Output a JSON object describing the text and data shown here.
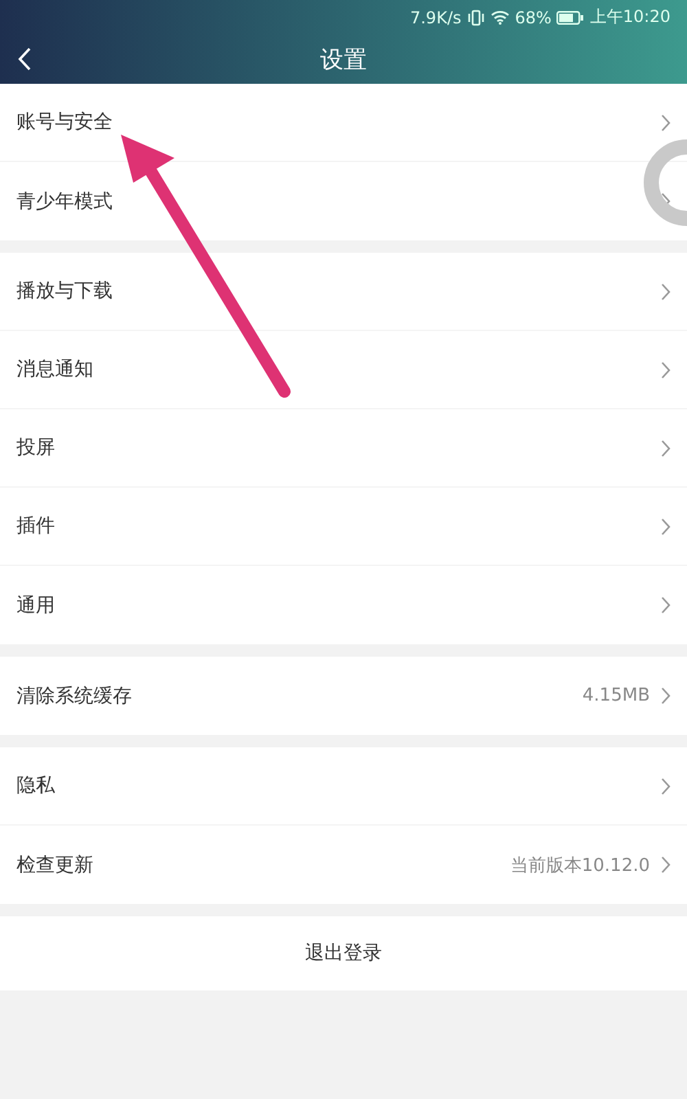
{
  "status_bar": {
    "network_speed": "7.9K/s",
    "battery": "68%",
    "time": "上午10:20"
  },
  "header": {
    "title": "设置"
  },
  "groups": [
    {
      "items": [
        {
          "label": "账号与安全"
        },
        {
          "label": "青少年模式"
        }
      ]
    },
    {
      "items": [
        {
          "label": "播放与下载"
        },
        {
          "label": "消息通知"
        },
        {
          "label": "投屏"
        },
        {
          "label": "插件"
        },
        {
          "label": "通用"
        }
      ]
    },
    {
      "items": [
        {
          "label": "清除系统缓存",
          "value": "4.15MB"
        }
      ]
    },
    {
      "items": [
        {
          "label": "隐私"
        },
        {
          "label": "检查更新",
          "value": "当前版本10.12.0"
        }
      ]
    }
  ],
  "logout": {
    "label": "退出登录"
  }
}
